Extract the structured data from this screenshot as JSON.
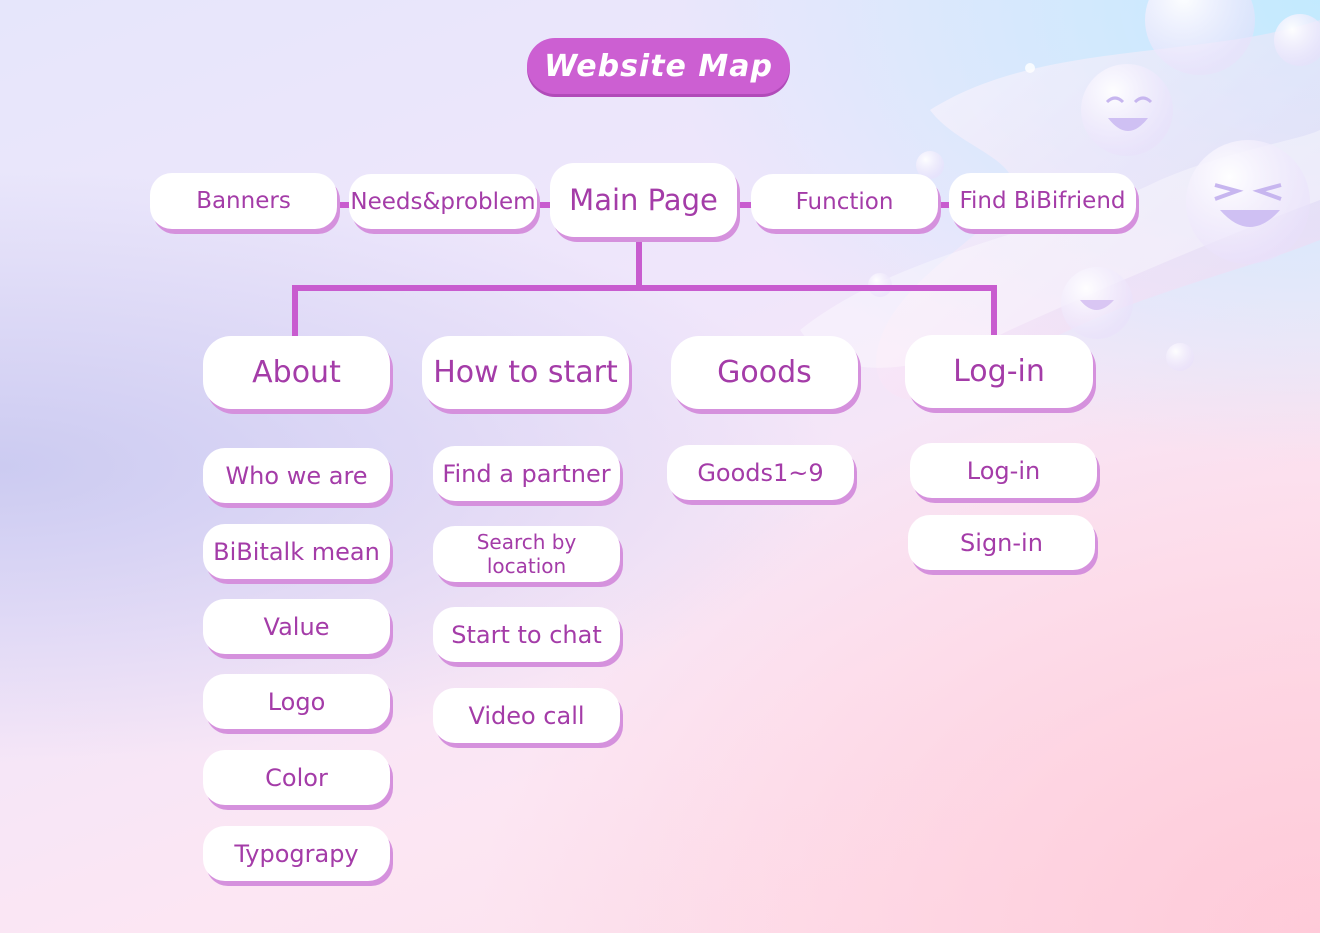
{
  "title": "Website Map",
  "colors": {
    "accent": "#cc5fd2",
    "connector": "#c85ccf",
    "node_text": "#a43ca8",
    "node_shadow": "#d591dd"
  },
  "main_page": "Main Page",
  "top_row": [
    "Banners",
    "Needs&problem",
    "Function",
    "Find BiBifriend"
  ],
  "sections": [
    {
      "label": "About",
      "children": [
        "Who we are",
        "BiBitalk mean",
        "Value",
        "Logo",
        "Color",
        "Typograpy"
      ]
    },
    {
      "label": "How to start",
      "children": [
        "Find a partner",
        "Search by location",
        "Start to chat",
        "Video call"
      ]
    },
    {
      "label": "Goods",
      "children": [
        "Goods1~9"
      ]
    },
    {
      "label": "Log-in",
      "children": [
        "Log-in",
        "Sign-in"
      ]
    }
  ]
}
